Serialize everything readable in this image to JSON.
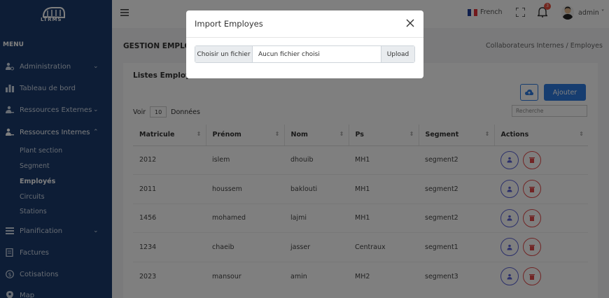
{
  "app": {
    "logo_text": "LTRMS"
  },
  "sidebar": {
    "heading": "MENU",
    "items": [
      {
        "label": "Administration",
        "icon": "users-cog-icon",
        "has_chevron": true,
        "chevron": "⌄"
      },
      {
        "label": "Tableau de bord",
        "icon": "bar-chart-icon",
        "has_chevron": false
      },
      {
        "label": "Ressources Externes",
        "icon": "user-minus-icon",
        "has_chevron": true,
        "chevron": "⌄"
      },
      {
        "label": "Ressources Internes",
        "icon": "user-group-icon",
        "has_chevron": true,
        "chevron": "⌃"
      },
      {
        "label": "Planification",
        "icon": "list-icon",
        "has_chevron": true,
        "chevron": "⌄"
      },
      {
        "label": "Factures",
        "icon": "invoice-icon",
        "has_chevron": false
      },
      {
        "label": "Cotisations",
        "icon": "dollar-circle-icon",
        "has_chevron": false
      },
      {
        "label": "Map",
        "icon": "map-pin-icon",
        "has_chevron": false
      }
    ],
    "subitems": [
      {
        "label": "Plant section"
      },
      {
        "label": "Segment"
      },
      {
        "label": "Employés"
      },
      {
        "label": "Circuits"
      },
      {
        "label": "Stations"
      }
    ]
  },
  "topbar": {
    "language": "French",
    "notification_count": "3",
    "user": "admin"
  },
  "page": {
    "title": "GESTION EMPLOY",
    "breadcrumb": "Collaborateurs Internes  /  Employes"
  },
  "card": {
    "title": "Listes Employe",
    "add_label": "Ajouter",
    "voir_label": "Voir",
    "page_size": "10",
    "donnees_label": "Données",
    "search_placeholder": "Recherche"
  },
  "table": {
    "columns": [
      "Matricule",
      "Prénom",
      "Nom",
      "Ps",
      "Segment",
      "Actions"
    ],
    "rows": [
      [
        "2012",
        "islem",
        "dhouib",
        "MH1",
        "segment2"
      ],
      [
        "2011",
        "houssem",
        "baklouti",
        "MH1",
        "segment2"
      ],
      [
        "1456",
        "mohamed",
        "lajmi",
        "MH1",
        "segment2"
      ],
      [
        "1234",
        "chaeib",
        "jasser",
        "Centraux",
        "segment1"
      ],
      [
        "2023",
        "mansour",
        "amin",
        "MH2",
        "segment3"
      ]
    ]
  },
  "modal": {
    "title": "Import Employes",
    "choose_label": "Choisir un fichier",
    "no_file_label": "Aucun fichier choisi",
    "upload_label": "Upload"
  },
  "colors": {
    "sidebar": "#1a3b6d",
    "primary": "#2d7be0",
    "danger": "#e24a4a",
    "edit": "#5b63d6"
  }
}
